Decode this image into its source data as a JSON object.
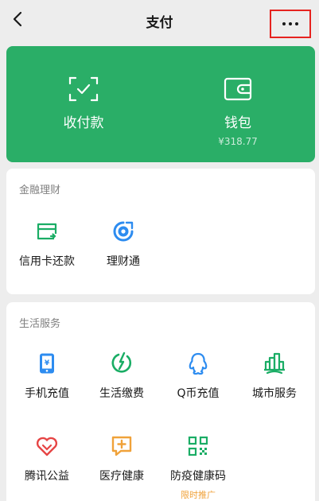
{
  "header": {
    "title": "支付",
    "back_icon": "back-arrow-icon",
    "more_icon": "more-dots-icon"
  },
  "top_card": {
    "color": "#2aae67",
    "items": [
      {
        "label": "收付款",
        "icon": "scan-pay-icon"
      },
      {
        "label": "钱包",
        "sub": "¥318.77",
        "icon": "wallet-icon"
      }
    ]
  },
  "finance": {
    "title": "金融理财",
    "items": [
      {
        "label": "信用卡还款",
        "icon": "credit-card-icon"
      },
      {
        "label": "理财通",
        "icon": "licaitong-icon"
      }
    ]
  },
  "services": {
    "title": "生活服务",
    "items": [
      {
        "label": "手机充值",
        "icon": "phone-topup-icon"
      },
      {
        "label": "生活缴费",
        "icon": "utility-bill-icon"
      },
      {
        "label": "Q币充值",
        "icon": "qcoin-icon"
      },
      {
        "label": "城市服务",
        "icon": "city-service-icon"
      },
      {
        "label": "腾讯公益",
        "icon": "charity-icon"
      },
      {
        "label": "医疗健康",
        "icon": "medical-icon"
      },
      {
        "label": "防疫健康码",
        "tag": "限时推广",
        "icon": "health-code-icon"
      }
    ]
  }
}
